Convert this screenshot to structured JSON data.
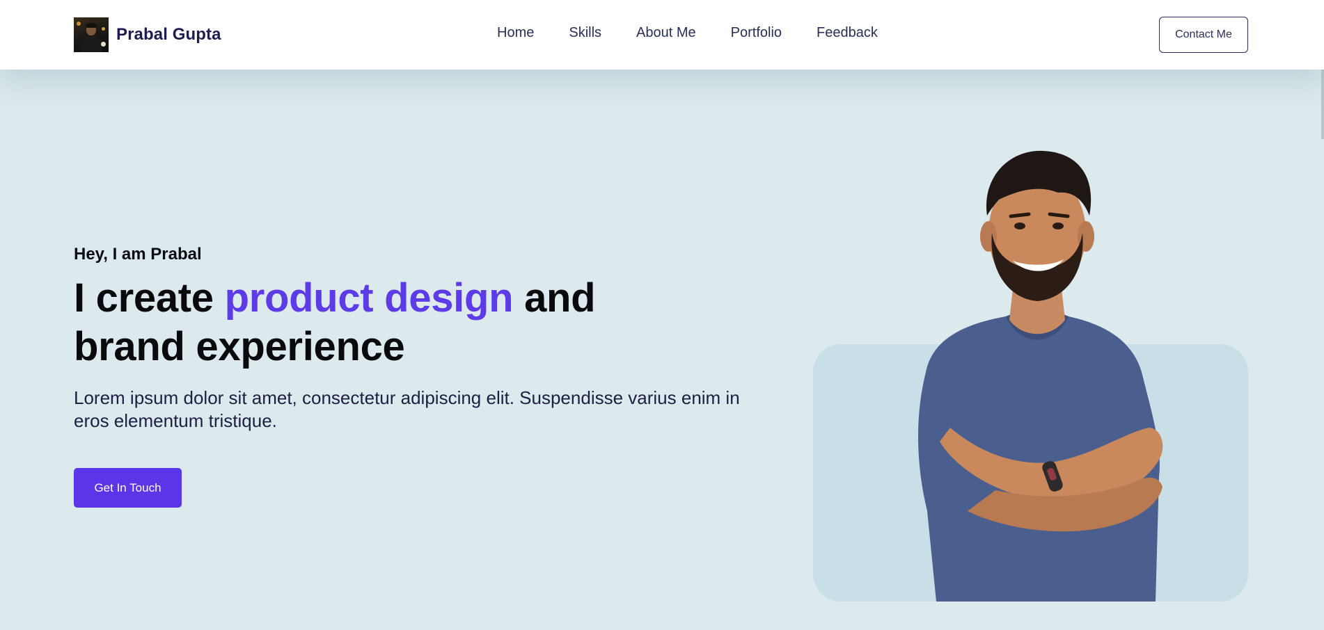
{
  "navbar": {
    "brand_name": "Prabal Gupta",
    "links": [
      {
        "label": "Home"
      },
      {
        "label": "Skills"
      },
      {
        "label": "About Me"
      },
      {
        "label": "Portfolio"
      },
      {
        "label": "Feedback"
      }
    ],
    "contact_label": "Contact Me"
  },
  "hero": {
    "greeting": "Hey, I am Prabal",
    "title_part1": "I create ",
    "title_accent": "product design",
    "title_part2": " and brand experience",
    "description": "Lorem ipsum dolor sit amet, consectetur adipiscing elit. Suspendisse varius enim in eros elementum tristique.",
    "cta_label": "Get In Touch"
  },
  "colors": {
    "accent": "#5a36e8",
    "hero_background": "#dce9ed",
    "photo_card_background": "#c8dfe8",
    "brand_text": "#1f1d4f"
  }
}
